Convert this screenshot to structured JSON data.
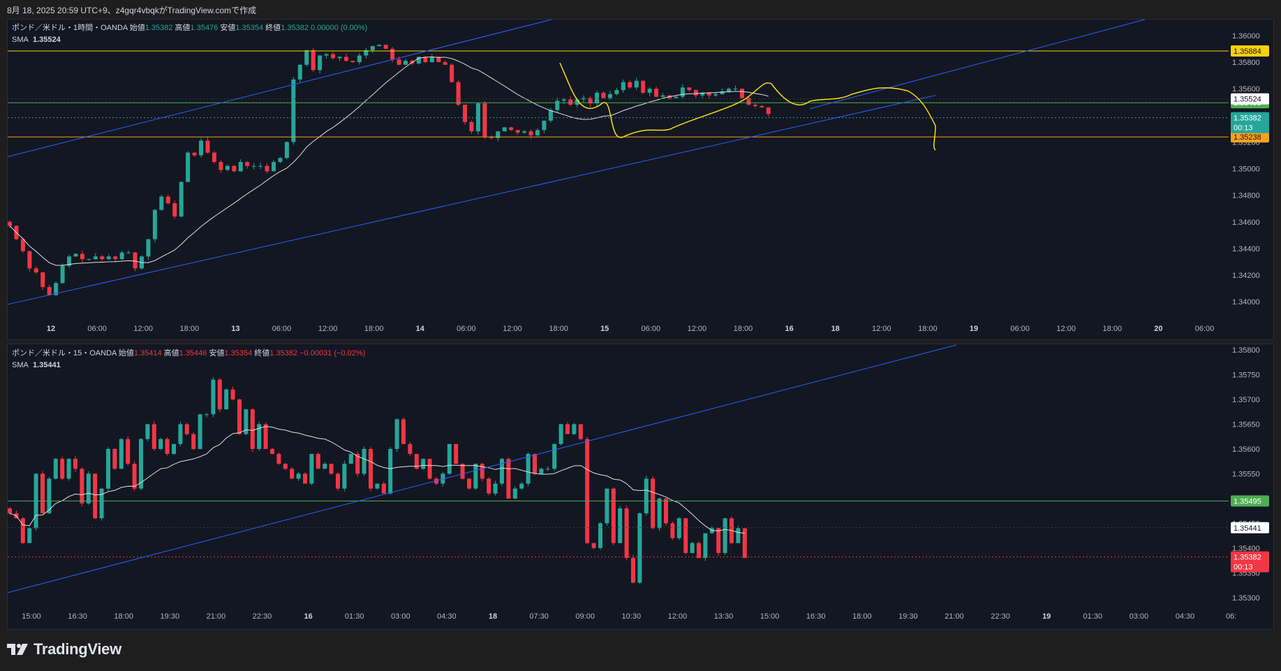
{
  "header": {
    "text": "8月 18, 2025 20:59 UTC+9、z4gqr4vbqkがTradingView.comで作成"
  },
  "brand": {
    "logo_text": "TradingView"
  },
  "colors": {
    "up": "#26a69a",
    "down": "#f23645",
    "sma": "#e0e0e0",
    "channel": "#2962ff",
    "hline_yellow": "#f7d00e",
    "hline_green": "#4caf50",
    "hline_orange": "#f7a21b",
    "drawing": "#f7e00e"
  },
  "chart_data": [
    {
      "type": "candlestick",
      "legend": {
        "symbol": "ポンド／米ドル・1時間・OANDA",
        "open_label": "始値",
        "open": "1.35382",
        "high_label": "高値",
        "high": "1.35476",
        "low_label": "安値",
        "low": "1.35354",
        "close_label": "終値",
        "close": "1.35382",
        "change": "0.00000 (0.00%)",
        "indicator_label": "SMA",
        "indicator_value": "1.35524"
      },
      "y_ticks": [
        "1.36000",
        "1.35800",
        "1.35600",
        "1.35400",
        "1.35200",
        "1.35000",
        "1.34800",
        "1.34600",
        "1.34400",
        "1.34200",
        "1.34000"
      ],
      "ylim": [
        1.3388,
        1.3612
      ],
      "x_ticks": [
        "12",
        "06:00",
        "12:00",
        "18:00",
        "13",
        "06:00",
        "12:00",
        "18:00",
        "14",
        "06:00",
        "12:00",
        "18:00",
        "15",
        "06:00",
        "12:00",
        "18:00",
        "16",
        "18",
        "12:00",
        "18:00",
        "19",
        "06:00",
        "12:00",
        "18:00",
        "20",
        "06:00"
      ],
      "x_ticks_bold": [
        "12",
        "13",
        "14",
        "15",
        "16",
        "18",
        "19",
        "20"
      ],
      "closes": [
        1.3457,
        1.3447,
        1.3438,
        1.3425,
        1.3422,
        1.3411,
        1.3405,
        1.3414,
        1.3427,
        1.3434,
        1.3436,
        1.3432,
        1.3432,
        1.3434,
        1.3432,
        1.3434,
        1.3432,
        1.3437,
        1.3437,
        1.3425,
        1.3434,
        1.3447,
        1.3469,
        1.3479,
        1.3474,
        1.3464,
        1.349,
        1.3512,
        1.351,
        1.3521,
        1.3512,
        1.3505,
        1.3499,
        1.3502,
        1.3498,
        1.3505,
        1.3502,
        1.3502,
        1.3502,
        1.3498,
        1.3505,
        1.3508,
        1.352,
        1.3567,
        1.3578,
        1.3589,
        1.3574,
        1.3585,
        1.3586,
        1.3583,
        1.3584,
        1.3581,
        1.358,
        1.3585,
        1.3589,
        1.3592,
        1.3593,
        1.359,
        1.3582,
        1.3578,
        1.3581,
        1.3579,
        1.3584,
        1.358,
        1.3584,
        1.358,
        1.3578,
        1.3565,
        1.3548,
        1.3535,
        1.3528,
        1.3549,
        1.3524,
        1.3523,
        1.3528,
        1.3531,
        1.3529,
        1.3527,
        1.3528,
        1.3525,
        1.3529,
        1.3536,
        1.3544,
        1.3551,
        1.3552,
        1.3548,
        1.3552,
        1.3553,
        1.3549,
        1.3557,
        1.3553,
        1.3556,
        1.3559,
        1.3565,
        1.3561,
        1.3566,
        1.3557,
        1.356,
        1.3554,
        1.3555,
        1.3553,
        1.3554,
        1.3561,
        1.3559,
        1.3555,
        1.3557,
        1.3555,
        1.3556,
        1.3558,
        1.356,
        1.356,
        1.3553,
        1.3548,
        1.3547,
        1.3546,
        1.3541
      ],
      "sma_label": "1.35524",
      "hlines": [
        {
          "value": 1.35884,
          "label": "1.35884",
          "color": "#f7d00e",
          "text_color": "#131722"
        },
        {
          "value": 1.35495,
          "label": "1.35495",
          "color": "#4caf50",
          "text_color": "#ffffff"
        },
        {
          "value": 1.35238,
          "label": "1.35238",
          "color": "#f7a21b",
          "text_color": "#131722"
        }
      ],
      "price_badges": [
        {
          "value": 1.35524,
          "label": "1.35524",
          "bg": "#ffffff",
          "fg": "#131722"
        },
        {
          "value": 1.35382,
          "label": "1.35382",
          "sub": "00:13",
          "bg": "#26a69a",
          "fg": "#ffffff"
        }
      ]
    },
    {
      "type": "candlestick",
      "legend": {
        "symbol": "ポンド／米ドル・15・OANDA",
        "open_label": "始値",
        "open": "1.35414",
        "high_label": "高値",
        "high": "1.35446",
        "low_label": "安値",
        "low": "1.35354",
        "close_label": "終値",
        "close": "1.35382",
        "change": "−0.00031 (−0.02%)",
        "indicator_label": "SMA",
        "indicator_value": "1.35441"
      },
      "y_ticks": [
        "1.35800",
        "1.35750",
        "1.35700",
        "1.35650",
        "1.35600",
        "1.35550",
        "1.35500",
        "1.35450",
        "1.35400",
        "1.35350",
        "1.35300"
      ],
      "ylim": [
        1.3528,
        1.3581
      ],
      "x_ticks": [
        "15:00",
        "16:30",
        "18:00",
        "19:30",
        "21:00",
        "22:30",
        "16",
        "01:30",
        "03:00",
        "04:30",
        "18",
        "07:30",
        "09:00",
        "10:30",
        "12:00",
        "13:30",
        "15:00",
        "16:30",
        "18:00",
        "19:30",
        "21:00",
        "22:30",
        "19",
        "01:30",
        "03:00",
        "04:30",
        "06:"
      ],
      "x_ticks_bold": [
        "16",
        "18",
        "19"
      ],
      "closes": [
        1.3547,
        1.3546,
        1.3541,
        1.3544,
        1.3555,
        1.3547,
        1.3554,
        1.3558,
        1.3554,
        1.3558,
        1.3556,
        1.3549,
        1.3555,
        1.3546,
        1.3552,
        1.356,
        1.3556,
        1.3562,
        1.3557,
        1.3552,
        1.3562,
        1.3565,
        1.356,
        1.3562,
        1.3559,
        1.3561,
        1.3565,
        1.3563,
        1.356,
        1.3567,
        1.3567,
        1.3574,
        1.3568,
        1.3572,
        1.357,
        1.3563,
        1.3568,
        1.356,
        1.3565,
        1.356,
        1.3559,
        1.3557,
        1.3556,
        1.3554,
        1.3555,
        1.3553,
        1.3559,
        1.3556,
        1.3557,
        1.3555,
        1.3552,
        1.3557,
        1.3559,
        1.3555,
        1.356,
        1.3552,
        1.3553,
        1.3551,
        1.356,
        1.3566,
        1.3561,
        1.3559,
        1.3556,
        1.3558,
        1.3554,
        1.3553,
        1.3555,
        1.3561,
        1.3557,
        1.3554,
        1.3552,
        1.3557,
        1.3554,
        1.3551,
        1.3553,
        1.3558,
        1.355,
        1.3552,
        1.3553,
        1.3559,
        1.3555,
        1.3556,
        1.3556,
        1.3561,
        1.3565,
        1.3563,
        1.3565,
        1.3562,
        1.3541,
        1.354,
        1.3545,
        1.3552,
        1.3541,
        1.3548,
        1.3538,
        1.3533,
        1.3547,
        1.3554,
        1.3544,
        1.355,
        1.3545,
        1.3542,
        1.3546,
        1.3539,
        1.3541,
        1.3538,
        1.3543,
        1.3544,
        1.3539,
        1.3546,
        1.3541,
        1.3544,
        1.3538
      ],
      "hlines": [
        {
          "value": 1.35495,
          "label": "1.35495",
          "color": "#4caf50",
          "text_color": "#ffffff"
        }
      ],
      "price_badges": [
        {
          "value": 1.35441,
          "label": "1.35441",
          "bg": "#ffffff",
          "fg": "#131722"
        },
        {
          "value": 1.35382,
          "label": "1.35382",
          "sub": "00:13",
          "bg": "#f23645",
          "fg": "#ffffff"
        }
      ]
    }
  ]
}
